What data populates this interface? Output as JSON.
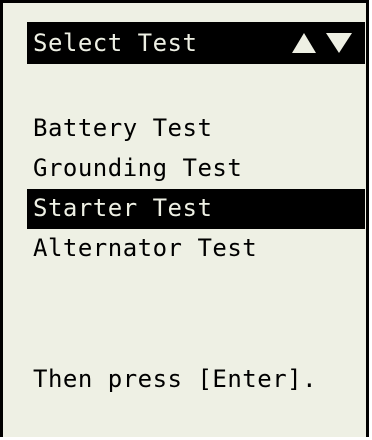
{
  "header": {
    "title": "Select Test",
    "scroll_icon": "up-down-arrows"
  },
  "menu": {
    "items": [
      {
        "label": "Battery Test"
      },
      {
        "label": "Grounding Test"
      },
      {
        "label": "Starter Test"
      },
      {
        "label": "Alternator Test"
      }
    ],
    "selected_index": 2
  },
  "footer": {
    "instruction": "Then press [Enter]."
  },
  "colors": {
    "screen_background": "#eef0e4",
    "foreground": "#000000",
    "highlight_background": "#000000",
    "highlight_text": "#eef0e4"
  }
}
